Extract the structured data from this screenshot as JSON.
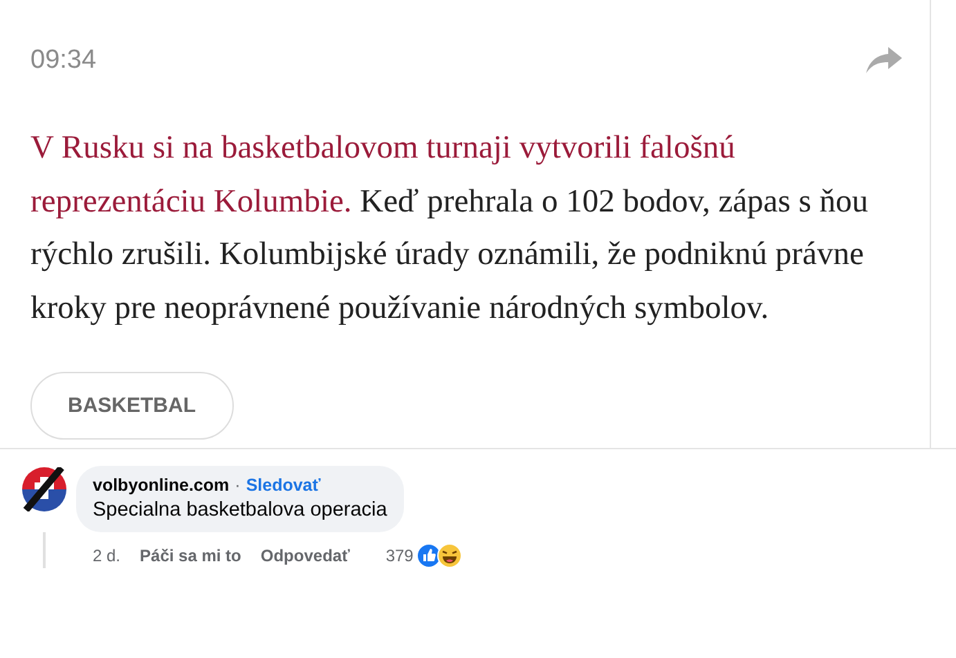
{
  "post": {
    "time": "09:34",
    "lead": "V Rusku si na basketbalovom turnaji vytvorili falošnú reprezentáciu Kolumbie.",
    "body": "Keď prehrala o 102 bodov, zápas s ňou rýchlo zrušili. Kolumbijské úrady oznámili, že podniknú právne kroky pre neoprávnené používanie národných symbolov.",
    "tags": [
      "BASKETBAL"
    ]
  },
  "comments": [
    {
      "author": "volbyonline.com",
      "separator": "·",
      "follow": "Sledovať",
      "text": "Specialna basketbalova operacia",
      "age": "2 d.",
      "actions": [
        "Páči sa mi to",
        "Odpovedať"
      ],
      "reaction_count": "379"
    }
  ]
}
